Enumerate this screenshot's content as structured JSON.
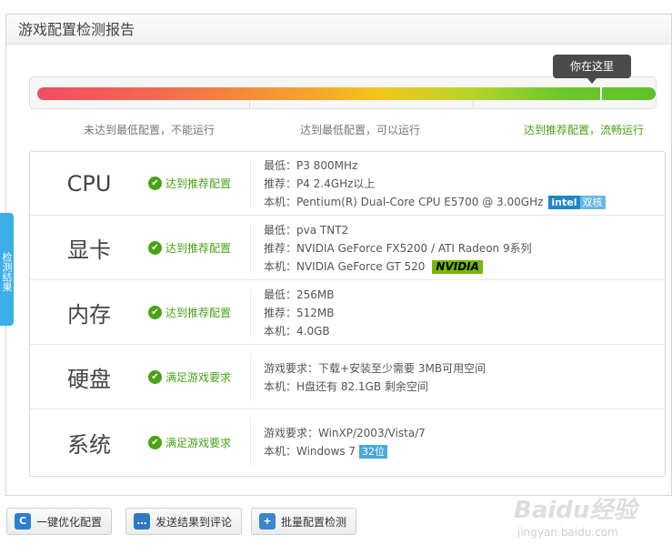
{
  "header": {
    "title": "游戏配置检测报告"
  },
  "progress": {
    "tooltip": "你在这里",
    "levels": [
      {
        "label": "未达到最低配置，不能运行"
      },
      {
        "label": "达到最低配置，可以运行"
      },
      {
        "label": "达到推荐配置，流畅运行"
      }
    ],
    "position_fraction": 0.91
  },
  "colors": {
    "ok_green": "#4aa317",
    "tooltip_bg": "#4a4a4a",
    "side_tab": "#3daee9"
  },
  "side_tab": {
    "label": "检测结果"
  },
  "rows": [
    {
      "name": "CPU",
      "status": "达到推荐配置",
      "lines": [
        "最低：P3 800MHz",
        "推荐：P4 2.4GHz以上",
        "本机：Pentium(R) Dual-Core CPU E5700 @ 3.00GHz"
      ],
      "badges": [
        "intel",
        "双核"
      ]
    },
    {
      "name": "显卡",
      "status": "达到推荐配置",
      "lines": [
        "最低：pva TNT2",
        "推荐：NVIDIA GeForce FX5200 / ATI Radeon 9系列",
        "本机：NVIDIA GeForce GT 520"
      ],
      "badges": [
        "NVIDIA"
      ]
    },
    {
      "name": "内存",
      "status": "达到推荐配置",
      "lines": [
        "最低：256MB",
        "推荐：512MB",
        "本机：4.0GB"
      ]
    },
    {
      "name": "硬盘",
      "status": "满足游戏要求",
      "lines": [
        "游戏要求：下载+安装至少需要 3MB可用空间",
        "本机：H盘还有 82.1GB 剩余空间"
      ]
    },
    {
      "name": "系统",
      "status": "满足游戏要求",
      "lines": [
        "游戏要求：WinXP/2003/Vista/7",
        "本机：Windows 7"
      ],
      "badges": [
        "32位"
      ]
    }
  ],
  "buttons": {
    "optimize": "一键优化配置",
    "send": "发送结果到评论",
    "batch": "批量配置检测"
  },
  "watermark": {
    "logo": "Baidu经验",
    "url": "jingyan.baidu.com"
  }
}
